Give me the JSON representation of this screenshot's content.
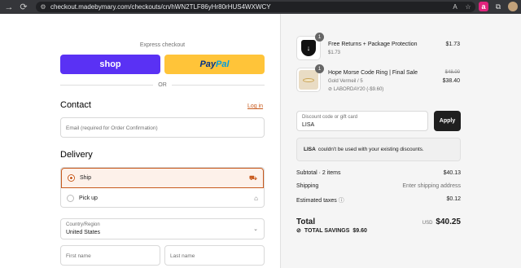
{
  "browser": {
    "url": "checkout.madebymary.com/checkouts/cn/hWN2TLF86yHr80rHUS4WXWCY"
  },
  "express": {
    "label": "Express checkout",
    "shop_label": "shop",
    "paypal_pay": "Pay",
    "paypal_pal": "Pal",
    "or_label": "OR"
  },
  "contact": {
    "title": "Contact",
    "login_label": "Log in",
    "email_placeholder": "Email (required for Order Confirmation)"
  },
  "delivery": {
    "title": "Delivery",
    "options": [
      {
        "label": "Ship",
        "selected": true,
        "icon": "truck-icon"
      },
      {
        "label": "Pick up",
        "selected": false,
        "icon": "store-icon"
      }
    ],
    "country_label": "Country/Region",
    "country_value": "United States",
    "first_name_placeholder": "First name",
    "last_name_placeholder": "Last name"
  },
  "cart": {
    "items": [
      {
        "qty": "1",
        "name": "Free Returns + Package Protection",
        "sub": "$1.73",
        "price": "$1.73"
      },
      {
        "qty": "1",
        "name": "Hope Morse Code Ring | Final Sale",
        "sub": "Gold Vermeil / 5",
        "discount": "LABORDAY20 (-$9.60)",
        "original_price": "$48.00",
        "price": "$38.40"
      }
    ],
    "discount_label": "Discount code or gift card",
    "discount_value": "LISA",
    "apply_label": "Apply",
    "notice_code": "LISA",
    "notice_text": "couldn't be used with your existing discounts."
  },
  "summary": {
    "subtotal_label": "Subtotal · 2 items",
    "subtotal_value": "$40.13",
    "shipping_label": "Shipping",
    "shipping_value": "Enter shipping address",
    "taxes_label": "Estimated taxes",
    "taxes_value": "$0.12",
    "total_label": "Total",
    "currency": "USD",
    "total_value": "$40.25",
    "savings_label": "TOTAL SAVINGS",
    "savings_value": "$9.60"
  }
}
